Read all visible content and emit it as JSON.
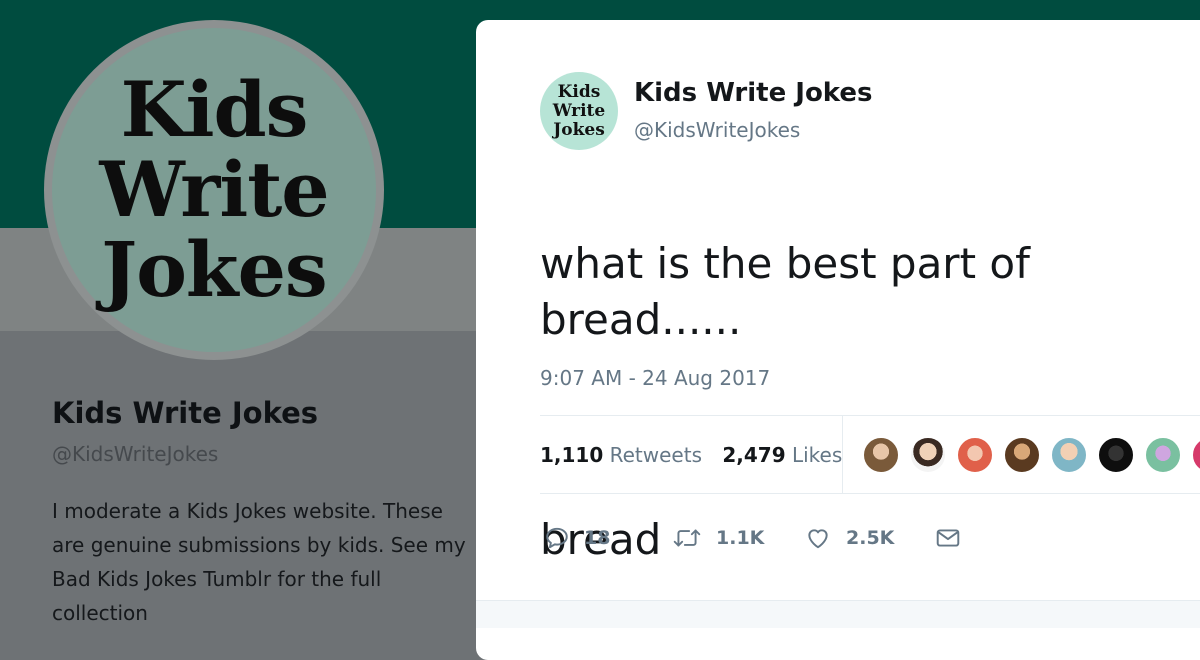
{
  "profile": {
    "avatar_text": [
      "Kids",
      "Write",
      "Jokes"
    ],
    "name": "Kids Write Jokes",
    "handle": "@KidsWriteJokes",
    "bio": "I moderate a Kids Jokes website. These are genuine submissions by kids. See my Bad Kids Jokes Tumblr for the full collection"
  },
  "tweet": {
    "avatar_text": [
      "Kids",
      "Write",
      "Jokes"
    ],
    "name": "Kids Write Jokes",
    "handle": "@KidsWriteJokes",
    "line1": "what is the best part of bread......",
    "line2": "bread",
    "timestamp": "9:07 AM - 24 Aug 2017",
    "retweets_count": "1,110",
    "retweets_label": "Retweets",
    "likes_count": "2,479",
    "likes_label": "Likes"
  },
  "actions": {
    "reply_count": "18",
    "retweet_count": "1.1K",
    "like_count": "2.5K"
  },
  "icons": {
    "reply": "reply-icon",
    "retweet": "retweet-icon",
    "like": "heart-icon",
    "dm": "envelope-icon"
  },
  "colors": {
    "banner": "#004c3f",
    "avatar_bg": "#b7e4d6",
    "text_primary": "#14171a",
    "text_secondary": "#657786"
  }
}
